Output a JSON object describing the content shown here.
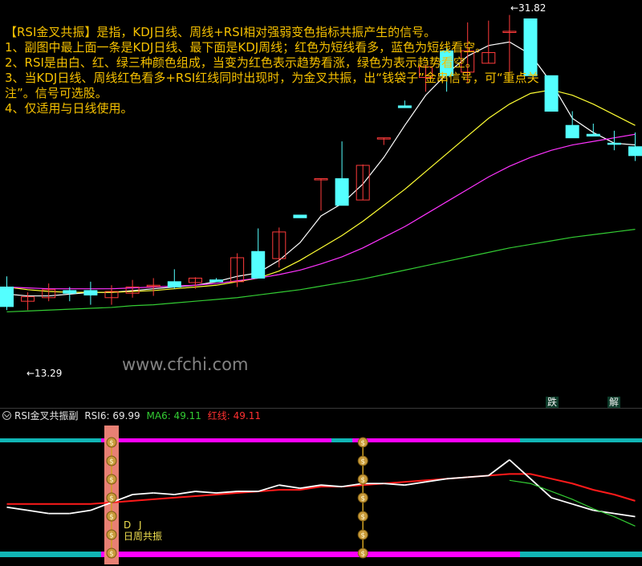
{
  "description": {
    "lines": [
      "【RSI金叉共振】是指，KDJ日线、周线+RSI相对强弱变色指标共振产生的信号。",
      "1、副图中最上面一条是KDJ日线、最下面是KDJ周线；红色为短线看多，蓝色为短线看空。",
      "2、RSI是由白、红、绿三种颜色组成，当变为红色表示趋势看涨，绿色为表示趋势看空。",
      "3、当KDJ日线、周线红色看多+RSI红线同时出现时，为金叉共振，出“钱袋子”金串信号，可“重点关",
      "注”。信号可选股。",
      "4、仅适用与日线使用。"
    ]
  },
  "watermark": "www.cfchi.com",
  "price_labels": {
    "low": "←13.29",
    "high": "←31.82"
  },
  "tags": [
    "跌",
    "解"
  ],
  "sub_header": {
    "name": "RSI金叉共振副",
    "rsi_label": "RSI6: 69.99",
    "ma_label": "MA6: 49.11",
    "red_label": "红线: 49.11"
  },
  "signal_label": {
    "line1": "D J",
    "line2": "日周共振"
  },
  "colors": {
    "up": "#ff3b3b",
    "down": "#54ffff",
    "ma_white": "#ffffff",
    "ma_yellow": "#ffff33",
    "ma_magenta": "#ff33ff",
    "ma_green": "#33cc33",
    "kdj_bull": "#ff00ff",
    "kdj_bear": "#11b5b5",
    "rsi_red": "#ff1a1a",
    "rsi_white": "#ffffff",
    "rsi_green": "#33cc33",
    "signal_bar": "#f4877a",
    "text_yellow": "#f5c000"
  },
  "chart_data": {
    "type": "candlestick",
    "price_range": [
      10.6,
      32.3
    ],
    "candles": [
      {
        "o": 16.5,
        "h": 17.1,
        "l": 15.2,
        "c": 15.4
      },
      {
        "o": 15.7,
        "h": 16.2,
        "l": 15.2,
        "c": 15.95
      },
      {
        "o": 15.9,
        "h": 16.7,
        "l": 15.7,
        "c": 16.35
      },
      {
        "o": 16.3,
        "h": 16.5,
        "l": 15.7,
        "c": 16.15
      },
      {
        "o": 16.3,
        "h": 16.8,
        "l": 15.5,
        "c": 16.05
      },
      {
        "o": 15.9,
        "h": 16.6,
        "l": 15.5,
        "c": 16.25
      },
      {
        "o": 16.15,
        "h": 16.9,
        "l": 15.9,
        "c": 16.5
      },
      {
        "o": 16.6,
        "h": 17.0,
        "l": 16.0,
        "c": 16.6
      },
      {
        "o": 16.8,
        "h": 17.5,
        "l": 16.4,
        "c": 16.5
      },
      {
        "o": 16.75,
        "h": 17.05,
        "l": 16.4,
        "c": 17.0
      },
      {
        "o": 16.9,
        "h": 17.0,
        "l": 16.8,
        "c": 16.8
      },
      {
        "o": 16.8,
        "h": 18.4,
        "l": 16.5,
        "c": 18.15
      },
      {
        "o": 18.5,
        "h": 19.8,
        "l": 17.6,
        "c": 17.0
      },
      {
        "o": 18.1,
        "h": 19.85,
        "l": 17.6,
        "c": 19.6
      },
      {
        "o": 20.55,
        "h": 20.55,
        "l": 20.4,
        "c": 20.4
      },
      {
        "o": 22.6,
        "h": 22.6,
        "l": 20.8,
        "c": 22.6
      },
      {
        "o": 22.6,
        "h": 24.7,
        "l": 21.1,
        "c": 21.1
      },
      {
        "o": 21.4,
        "h": 23.4,
        "l": 21.4,
        "c": 23.35
      },
      {
        "o": 24.9,
        "h": 24.9,
        "l": 24.5,
        "c": 24.9
      },
      {
        "o": 26.7,
        "h": 27.0,
        "l": 26.7,
        "c": 26.6
      },
      {
        "o": 28.3,
        "h": 29.0,
        "l": 27.5,
        "c": 28.9
      },
      {
        "o": 29.8,
        "h": 30.0,
        "l": 27.5,
        "c": 28.4
      },
      {
        "o": 28.6,
        "h": 31.4,
        "l": 28.0,
        "c": 29.8
      },
      {
        "o": 29.1,
        "h": 31.5,
        "l": 29.1,
        "c": 29.7
      },
      {
        "o": 30.9,
        "h": 31.82,
        "l": 28.6,
        "c": 30.9
      },
      {
        "o": 31.6,
        "h": 31.6,
        "l": 28.4,
        "c": 28.4
      },
      {
        "o": 28.4,
        "h": 28.4,
        "l": 26.5,
        "c": 26.4
      },
      {
        "o": 25.6,
        "h": 26.4,
        "l": 24.9,
        "c": 24.9
      },
      {
        "o": 25.1,
        "h": 25.7,
        "l": 25.0,
        "c": 25.0
      },
      {
        "o": 24.6,
        "h": 25.3,
        "l": 24.2,
        "c": 24.55
      },
      {
        "o": 24.4,
        "h": 25.2,
        "l": 23.6,
        "c": 23.9
      }
    ],
    "ma_lines": [
      {
        "name": "white",
        "values": [
          16.1,
          16.0,
          16.0,
          16.1,
          16.2,
          16.2,
          16.3,
          16.4,
          16.5,
          16.6,
          16.8,
          17.1,
          17.3,
          18.0,
          19.0,
          20.5,
          21.2,
          22.3,
          23.8,
          25.6,
          27.3,
          28.5,
          29.5,
          30.1,
          30.3,
          29.6,
          28.0,
          26.0,
          25.2,
          24.6,
          24.5
        ]
      },
      {
        "name": "yellow",
        "values": [
          16.5,
          16.35,
          16.25,
          16.2,
          16.2,
          16.2,
          16.25,
          16.3,
          16.4,
          16.5,
          16.6,
          16.8,
          17.0,
          17.4,
          18.0,
          18.7,
          19.4,
          20.2,
          21.1,
          22.0,
          23.0,
          24.0,
          25.0,
          26.0,
          26.8,
          27.4,
          27.6,
          27.3,
          26.8,
          26.2,
          25.6
        ]
      },
      {
        "name": "magenta",
        "values": [
          16.5,
          16.45,
          16.4,
          16.4,
          16.4,
          16.4,
          16.45,
          16.5,
          16.55,
          16.6,
          16.7,
          16.85,
          17.0,
          17.2,
          17.45,
          17.8,
          18.2,
          18.7,
          19.3,
          19.9,
          20.6,
          21.3,
          22.0,
          22.7,
          23.3,
          23.8,
          24.2,
          24.5,
          24.7,
          24.9,
          25.1
        ]
      },
      {
        "name": "green",
        "values": [
          15.1,
          15.15,
          15.2,
          15.25,
          15.3,
          15.35,
          15.45,
          15.5,
          15.6,
          15.7,
          15.8,
          15.9,
          16.05,
          16.2,
          16.35,
          16.55,
          16.75,
          16.95,
          17.2,
          17.45,
          17.7,
          17.95,
          18.2,
          18.45,
          18.7,
          18.9,
          19.1,
          19.3,
          19.45,
          19.6,
          19.75
        ]
      }
    ],
    "rsi": [
      42,
      40,
      38,
      38,
      40,
      45,
      50,
      51,
      50,
      52,
      51,
      52,
      52,
      56,
      54,
      56,
      55,
      57,
      57,
      56,
      58,
      60,
      61,
      62,
      72,
      60,
      48,
      44,
      40,
      38,
      36
    ],
    "rsi_red_line": [
      44,
      44,
      44,
      44,
      44,
      45,
      46,
      47,
      48,
      49,
      50,
      51,
      52,
      53,
      53,
      55,
      55,
      56,
      57,
      58,
      59,
      60,
      61,
      62,
      63,
      63,
      60,
      57,
      53,
      50,
      46
    ],
    "kdj_daily": [
      "bear",
      "bear",
      "bear",
      "bear",
      "bear",
      "bull",
      "bull",
      "bull",
      "bull",
      "bull",
      "bull",
      "bull",
      "bull",
      "bull",
      "bull",
      "bull",
      "bear",
      "bull",
      "bull",
      "bull",
      "bull",
      "bull",
      "bull",
      "bull",
      "bull",
      "bear",
      "bear",
      "bear",
      "bear",
      "bear",
      "bear"
    ],
    "kdj_weekly": [
      "bear",
      "bear",
      "bear",
      "bear",
      "bear",
      "bull",
      "bull",
      "bull",
      "bull",
      "bull",
      "bull",
      "bull",
      "bull",
      "bull",
      "bull",
      "bull",
      "bull",
      "bull",
      "bull",
      "bull",
      "bull",
      "bull",
      "bull",
      "bull",
      "bull",
      "bear",
      "bear",
      "bear",
      "bear",
      "bear",
      "bear"
    ],
    "signals": [
      5,
      17
    ]
  }
}
